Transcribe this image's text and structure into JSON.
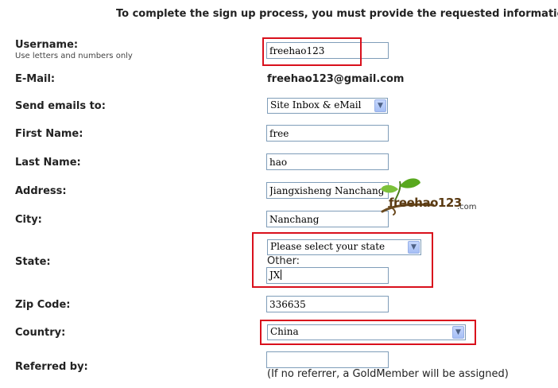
{
  "intro_text": "To complete the sign up process, you must provide the requested information",
  "fields": {
    "username": {
      "label": "Username:",
      "hint": "Use letters and numbers only",
      "value": "freehao123"
    },
    "email": {
      "label": "E-Mail:",
      "value": "freehao123@gmail.com"
    },
    "send_emails": {
      "label": "Send emails to:",
      "selected": "Site Inbox & eMail"
    },
    "first_name": {
      "label": "First Name:",
      "value": "free"
    },
    "last_name": {
      "label": "Last Name:",
      "value": "hao"
    },
    "address": {
      "label": "Address:",
      "value": "Jiangxisheng Nanchang"
    },
    "city": {
      "label": "City:",
      "value": "Nanchang"
    },
    "state": {
      "label": "State:",
      "selected": "Please select your state",
      "other_label": "Other:",
      "other_value": "JX"
    },
    "zip": {
      "label": "Zip Code:",
      "value": "336635"
    },
    "country": {
      "label": "Country:",
      "selected": "China"
    },
    "referred_by": {
      "label": "Referred by:",
      "value": "",
      "note": "(If no referrer, a GoldMember will be assigned)"
    }
  },
  "watermark": {
    "brand": "freehao123",
    "domain": ".com"
  },
  "colors": {
    "highlight_box": "#d9101c",
    "input_border": "#7f9db9",
    "dropdown_arrow": "#a6bff5"
  }
}
